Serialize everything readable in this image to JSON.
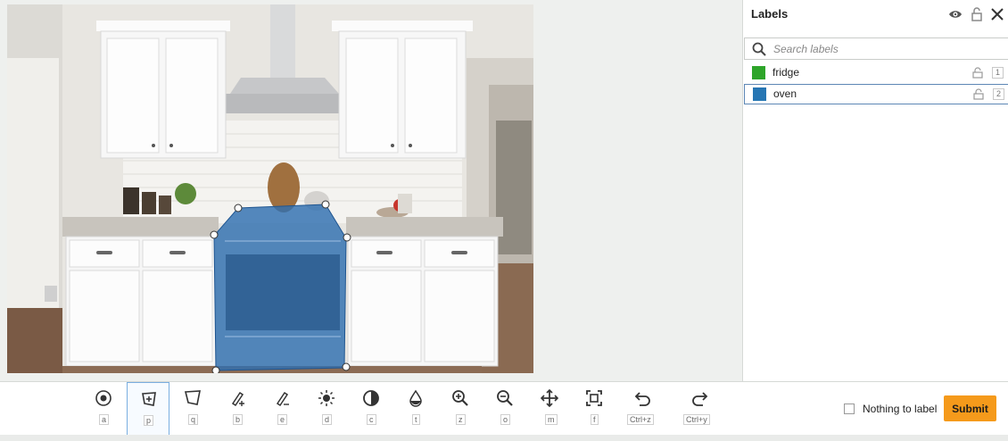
{
  "panel": {
    "title": "Labels",
    "search_placeholder": "Search labels",
    "header_icons": [
      "eye-icon",
      "lock-icon",
      "close-icon"
    ],
    "labels": [
      {
        "name": "fridge",
        "color": "#2ea52a",
        "hotkey": "1",
        "selected": false
      },
      {
        "name": "oven",
        "color": "#2676b3",
        "hotkey": "2",
        "selected": true
      }
    ]
  },
  "canvas": {
    "annotation_color": "#2f6fb0",
    "image_subject": "kitchen"
  },
  "toolbar": {
    "tools": [
      {
        "name": "point-tool",
        "icon": "point-icon",
        "key": "a"
      },
      {
        "name": "polygon-tool",
        "icon": "polygon-icon",
        "key": "p",
        "active": true
      },
      {
        "name": "box-polygon-tool",
        "icon": "quad-icon",
        "key": "q"
      },
      {
        "name": "brush-tool",
        "icon": "brush-add-icon",
        "key": "b"
      },
      {
        "name": "eraser-tool",
        "icon": "brush-erase-icon",
        "key": "e"
      },
      {
        "name": "brightness-tool",
        "icon": "sun-icon",
        "key": "d"
      },
      {
        "name": "contrast-tool",
        "icon": "contrast-icon",
        "key": "c"
      },
      {
        "name": "transparency-tool",
        "icon": "droplet-icon",
        "key": "t"
      },
      {
        "name": "zoom-in-tool",
        "icon": "zoom-in-icon",
        "key": "z"
      },
      {
        "name": "zoom-out-tool",
        "icon": "zoom-out-icon",
        "key": "o"
      },
      {
        "name": "move-tool",
        "icon": "move-icon",
        "key": "m"
      },
      {
        "name": "fit-tool",
        "icon": "fit-icon",
        "key": "f"
      },
      {
        "name": "undo-tool",
        "icon": "undo-icon",
        "key": "Ctrl+z"
      },
      {
        "name": "redo-tool",
        "icon": "redo-icon",
        "key": "Ctrl+y"
      }
    ],
    "nothing_to_label": "Nothing to label",
    "submit": "Submit"
  }
}
